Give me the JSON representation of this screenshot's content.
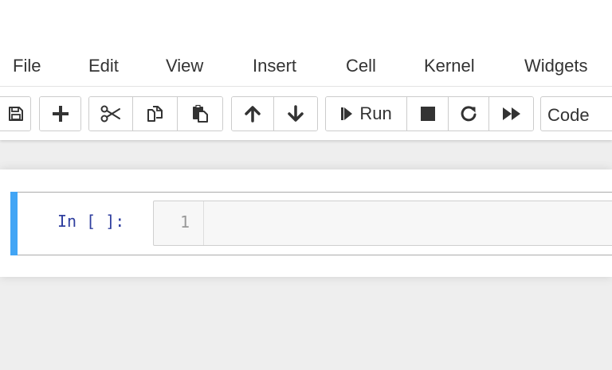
{
  "menubar": {
    "items": [
      {
        "label": "File"
      },
      {
        "label": "Edit"
      },
      {
        "label": "View"
      },
      {
        "label": "Insert"
      },
      {
        "label": "Cell"
      },
      {
        "label": "Kernel"
      },
      {
        "label": "Widgets"
      }
    ]
  },
  "toolbar": {
    "icons": {
      "save": "save-icon",
      "insert_cell": "plus-icon",
      "cut": "scissors-icon",
      "copy": "copy-icon",
      "paste": "paste-icon",
      "move_up": "arrow-up-icon",
      "move_down": "arrow-down-icon",
      "run": "step-forward-icon",
      "interrupt": "stop-icon",
      "restart": "refresh-icon",
      "restart_run_all": "fast-forward-icon"
    },
    "run_label": "Run",
    "cell_type": {
      "selected": "Code"
    }
  },
  "notebook": {
    "cells": [
      {
        "prompt": "In [ ]:",
        "line_number": "1",
        "source": ""
      }
    ]
  },
  "colors": {
    "cell_selected_bar": "#42a5f5",
    "prompt_in": "#303f9f",
    "page_background": "#eeeeee",
    "input_background": "#f7f7f7"
  }
}
